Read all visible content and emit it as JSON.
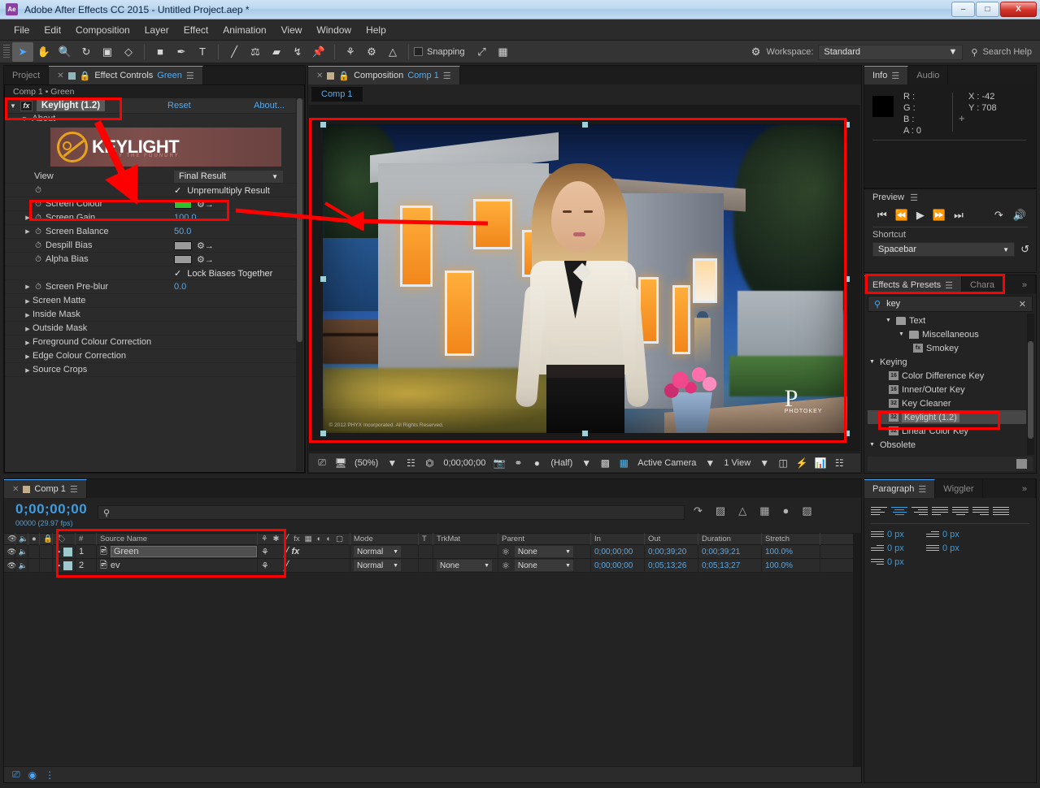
{
  "window": {
    "title": "Adobe After Effects CC 2015 - Untitled Project.aep *",
    "logo": "Ae",
    "minimize": "–",
    "maximize": "□",
    "close": "X"
  },
  "menubar": [
    "File",
    "Edit",
    "Composition",
    "Layer",
    "Effect",
    "Animation",
    "View",
    "Window",
    "Help"
  ],
  "toolbar": {
    "snapping_label": "Snapping",
    "workspace_label": "Workspace:",
    "workspace_value": "Standard",
    "search_help": "Search Help",
    "tools": [
      "selection-tool",
      "hand-tool",
      "zoom-tool",
      "rotation-tool",
      "camera-tool",
      "pan-behind-tool",
      "shape-tool",
      "pen-tool",
      "type-tool",
      "brush-tool",
      "clone-stamp-tool",
      "eraser-tool",
      "roto-brush-tool",
      "puppet-tool"
    ]
  },
  "effect_controls": {
    "tabs": [
      {
        "label": "Project",
        "active": false
      },
      {
        "label": "Effect Controls",
        "suffix": "Green",
        "active": true
      }
    ],
    "breadcrumb": "Comp 1 • Green",
    "effect_name": "Keylight (1.2)",
    "reset": "Reset",
    "about": "About...",
    "about_row": "About",
    "banner_word": "KEYLIGHT",
    "banner_sub": "BY THE FOUNDRY",
    "properties": [
      {
        "name": "View",
        "type": "select",
        "value": "Final Result"
      },
      {
        "name": "",
        "type": "checkbox",
        "value": "Unpremultiply Result"
      },
      {
        "name": "Screen Colour",
        "type": "color",
        "value": "#2fc12f"
      },
      {
        "name": "Screen Gain",
        "type": "number",
        "value": "100.0"
      },
      {
        "name": "Screen Balance",
        "type": "number",
        "value": "50.0"
      },
      {
        "name": "Despill Bias",
        "type": "color",
        "value": "#9a9a9a"
      },
      {
        "name": "Alpha Bias",
        "type": "color",
        "value": "#9a9a9a"
      },
      {
        "name": "",
        "type": "checkbox",
        "value": "Lock Biases Together"
      },
      {
        "name": "Screen Pre-blur",
        "type": "number",
        "value": "0.0"
      }
    ],
    "groups": [
      "Screen Matte",
      "Inside Mask",
      "Outside Mask",
      "Foreground Colour Correction",
      "Edge Colour Correction",
      "Source Crops"
    ]
  },
  "composition": {
    "tab_label": "Composition",
    "tab_name": "Comp 1",
    "sub_tab": "Comp 1",
    "toolbar": {
      "zoom": "(50%)",
      "timecode": "0;00;00;00",
      "resolution": "(Half)",
      "camera": "Active Camera",
      "views": "1 View"
    }
  },
  "info": {
    "tabs": [
      "Info",
      "Audio"
    ],
    "rgb": [
      "R :",
      "G :",
      "B :",
      "A : 0"
    ],
    "x": "X : -42",
    "y": "Y : 708"
  },
  "preview": {
    "title": "Preview",
    "shortcut_label": "Shortcut",
    "shortcut_value": "Spacebar"
  },
  "effects_presets": {
    "tabs": [
      "Effects & Presets",
      "Chara"
    ],
    "search_value": "key",
    "items": [
      {
        "label": "Text",
        "type": "folder",
        "indent": 1,
        "expanded": true
      },
      {
        "label": "Miscellaneous",
        "type": "folder",
        "indent": 2,
        "expanded": true
      },
      {
        "label": "Smokey",
        "type": "effect",
        "indent": 3,
        "bits": "fx"
      },
      {
        "label": "Keying",
        "type": "category",
        "indent": 0,
        "expanded": true
      },
      {
        "label": "Color Difference Key",
        "type": "effect",
        "indent": 1,
        "bits": "16"
      },
      {
        "label": "Inner/Outer Key",
        "type": "effect",
        "indent": 1,
        "bits": "16"
      },
      {
        "label": "Key Cleaner",
        "type": "effect",
        "indent": 1,
        "bits": "32"
      },
      {
        "label": "Keylight (1.2)",
        "type": "effect",
        "indent": 1,
        "bits": "32",
        "selected": true
      },
      {
        "label": "Linear Color Key",
        "type": "effect",
        "indent": 1,
        "bits": "32"
      },
      {
        "label": "Obsolete",
        "type": "category",
        "indent": 0,
        "expanded": true
      }
    ]
  },
  "timeline": {
    "tab_label": "Comp 1",
    "timecode": "0;00;00;00",
    "frame_info": "00000 (29.97 fps)",
    "columns": [
      "#",
      "Source Name",
      "Mode",
      "T",
      "TrkMat",
      "Parent",
      "In",
      "Out",
      "Duration",
      "Stretch"
    ],
    "layers": [
      {
        "index": "1",
        "name": "Green",
        "mode": "Normal",
        "trkmat": "",
        "parent": "None",
        "in": "0;00;00;00",
        "out": "0;00;39;20",
        "duration": "0;00;39;21",
        "stretch": "100.0%",
        "selected": true,
        "has_fx": true
      },
      {
        "index": "2",
        "name": "ev",
        "mode": "Normal",
        "trkmat": "None",
        "parent": "None",
        "in": "0;00;00;00",
        "out": "0;05;13;26",
        "duration": "0;05;13;27",
        "stretch": "100.0%",
        "selected": false,
        "has_fx": false
      }
    ]
  },
  "paragraph": {
    "tabs": [
      "Paragraph",
      "Wiggler"
    ],
    "indents": [
      {
        "name": "indent-left-margin",
        "value": "0 px"
      },
      {
        "name": "indent-first-line",
        "value": "0 px"
      },
      {
        "name": "space-before-paragraph",
        "value": "0 px"
      },
      {
        "name": "indent-right-margin",
        "value": "0 px"
      },
      {
        "name": "space-after-paragraph",
        "value": "0 px"
      }
    ]
  }
}
